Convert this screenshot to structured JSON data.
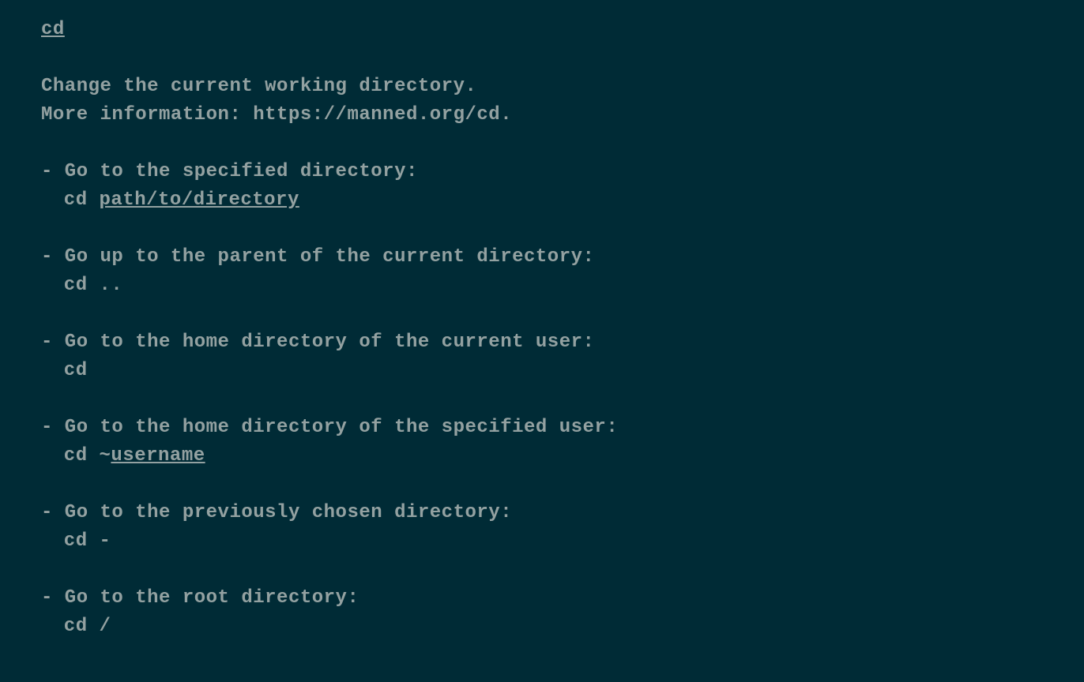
{
  "command": "cd",
  "description_line1": "Change the current working directory.",
  "description_line2": "More information: https://manned.org/cd.",
  "examples": [
    {
      "description": "- Go to the specified directory:",
      "cmd_parts": [
        {
          "text": "cd ",
          "underline": false
        },
        {
          "text": "path/to/directory",
          "underline": true
        }
      ]
    },
    {
      "description": "- Go up to the parent of the current directory:",
      "cmd_parts": [
        {
          "text": "cd ..",
          "underline": false
        }
      ]
    },
    {
      "description": "- Go to the home directory of the current user:",
      "cmd_parts": [
        {
          "text": "cd",
          "underline": false
        }
      ]
    },
    {
      "description": "- Go to the home directory of the specified user:",
      "cmd_parts": [
        {
          "text": "cd ~",
          "underline": false
        },
        {
          "text": "username",
          "underline": true
        }
      ]
    },
    {
      "description": "- Go to the previously chosen directory:",
      "cmd_parts": [
        {
          "text": "cd -",
          "underline": false
        }
      ]
    },
    {
      "description": "- Go to the root directory:",
      "cmd_parts": [
        {
          "text": "cd /",
          "underline": false
        }
      ]
    }
  ]
}
